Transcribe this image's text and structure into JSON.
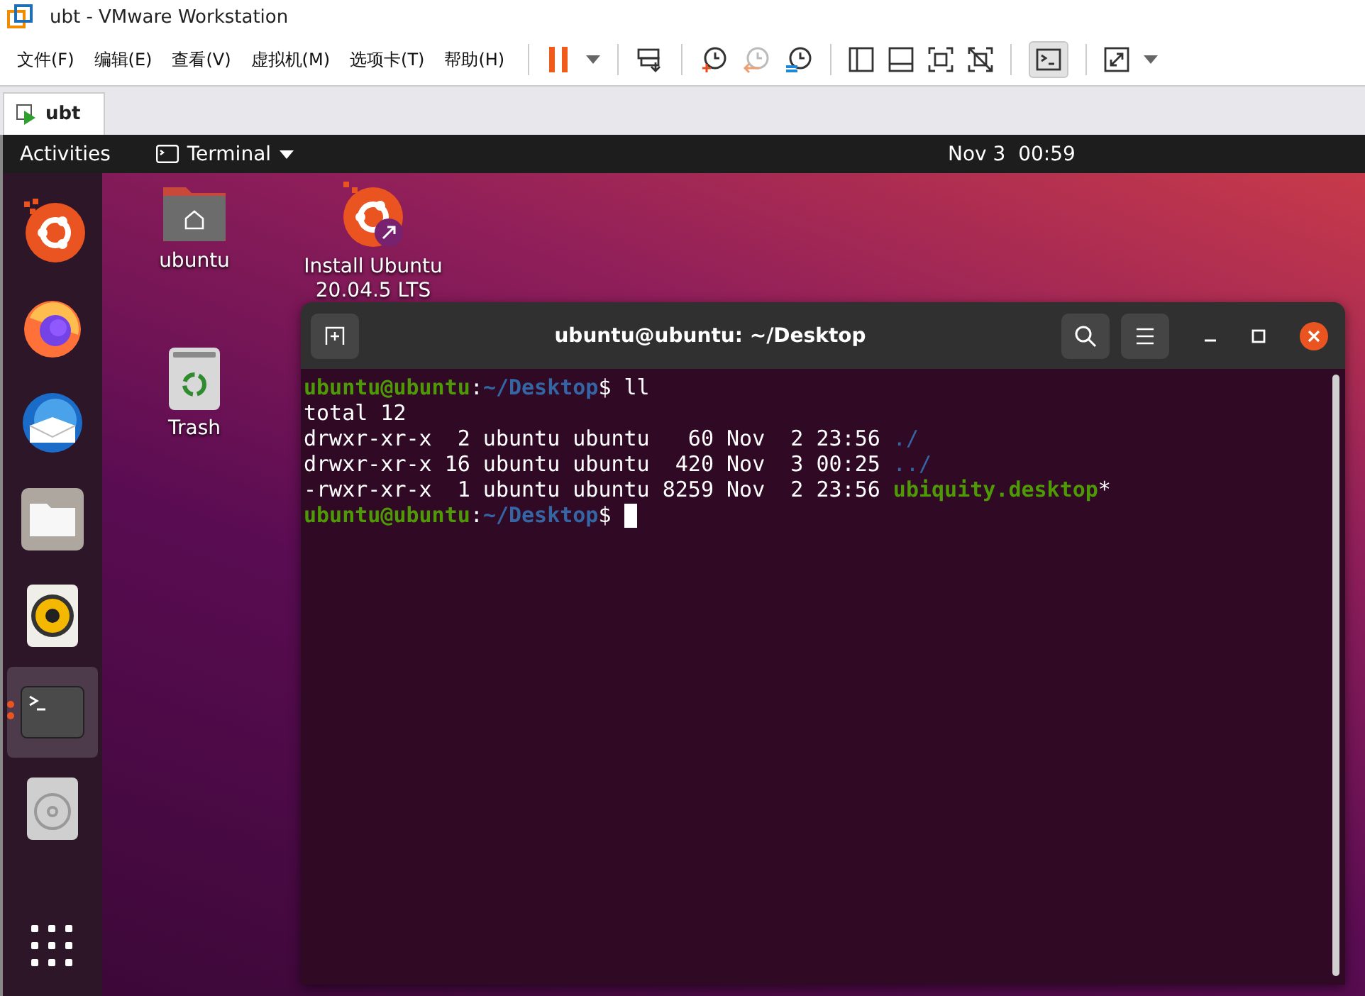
{
  "window": {
    "title": "ubt - VMware Workstation"
  },
  "menu": [
    "文件(F)",
    "编辑(E)",
    "查看(V)",
    "虚拟机(M)",
    "选项卡(T)",
    "帮助(H)"
  ],
  "tabs": [
    {
      "label": "ubt",
      "selected": true
    }
  ],
  "topbar": {
    "activities": "Activities",
    "app": "Terminal",
    "clock": "Nov 3  00:59"
  },
  "dock": [
    {
      "kind": "installer",
      "running": false,
      "selected": false
    },
    {
      "kind": "firefox",
      "running": false,
      "selected": false
    },
    {
      "kind": "mail",
      "running": false,
      "selected": false
    },
    {
      "kind": "files",
      "running": false,
      "selected": false
    },
    {
      "kind": "speaker",
      "running": false,
      "selected": false
    },
    {
      "kind": "terminal",
      "running": true,
      "selected": true
    },
    {
      "kind": "disc",
      "running": false,
      "selected": false
    }
  ],
  "desktop_icons": [
    {
      "kind": "home",
      "label": "ubuntu"
    },
    {
      "kind": "installer",
      "label": "Install Ubuntu\n20.04.5 LTS"
    },
    {
      "kind": "trash",
      "label": "Trash"
    }
  ],
  "terminal": {
    "title": "ubuntu@ubuntu: ~/Desktop",
    "lines": [
      [
        {
          "kind": "user",
          "text": "ubuntu@ubuntu"
        },
        {
          "kind": "plain",
          "text": ":"
        },
        {
          "kind": "path",
          "text": "~/Desktop"
        },
        {
          "kind": "plain",
          "text": "$ ll"
        }
      ],
      [
        {
          "kind": "plain",
          "text": "total 12"
        }
      ],
      [
        {
          "kind": "plain",
          "text": "drwxr-xr-x  2 ubuntu ubuntu   60 Nov  2 23:56 "
        },
        {
          "kind": "dir",
          "text": "./"
        }
      ],
      [
        {
          "kind": "plain",
          "text": "drwxr-xr-x 16 ubuntu ubuntu  420 Nov  3 00:25 "
        },
        {
          "kind": "dir",
          "text": "../"
        }
      ],
      [
        {
          "kind": "plain",
          "text": "-rwxr-xr-x  1 ubuntu ubuntu 8259 Nov  2 23:56 "
        },
        {
          "kind": "exec",
          "text": "ubiquity.desktop"
        },
        {
          "kind": "plain",
          "text": "*"
        }
      ],
      [
        {
          "kind": "user",
          "text": "ubuntu@ubuntu"
        },
        {
          "kind": "plain",
          "text": ":"
        },
        {
          "kind": "path",
          "text": "~/Desktop"
        },
        {
          "kind": "plain",
          "text": "$ "
        },
        {
          "kind": "cursor"
        }
      ]
    ]
  }
}
